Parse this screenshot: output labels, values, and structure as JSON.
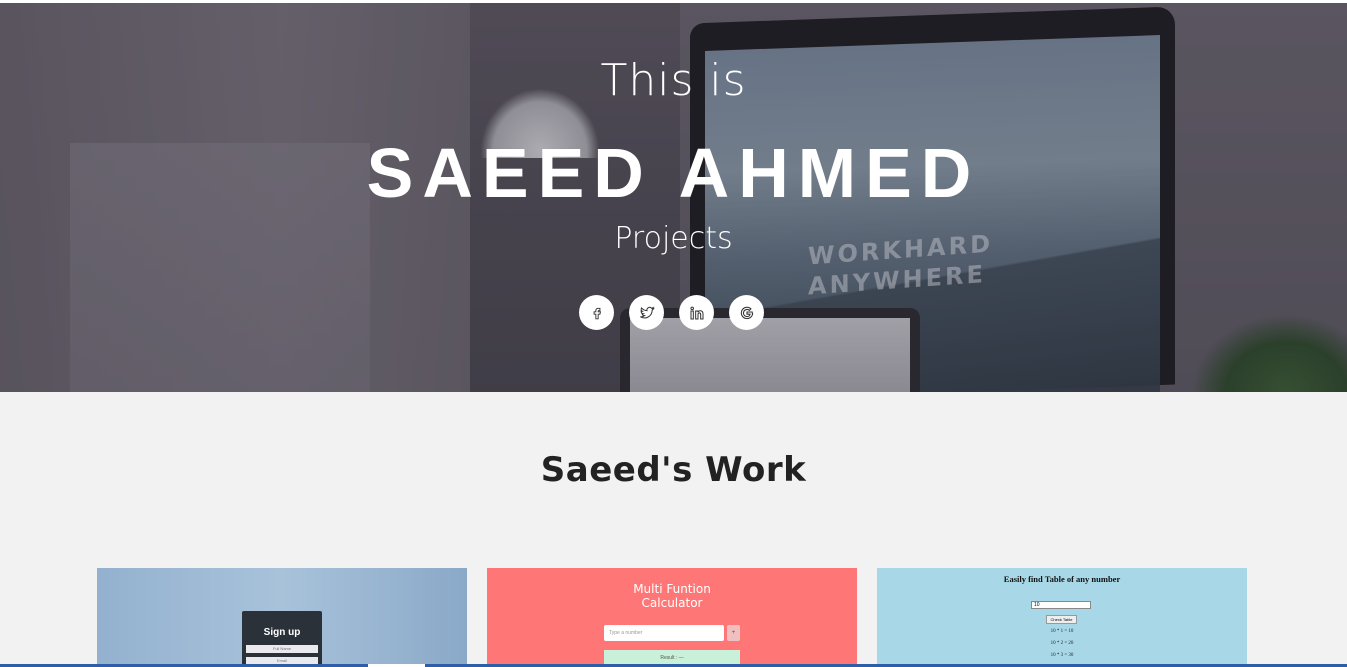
{
  "hero": {
    "intro": "This is",
    "name": "SAEED AHMED",
    "subtitle": "Projects",
    "background_text": "WORKHARD\nANYWHERE",
    "socials": [
      {
        "name": "facebook",
        "glyph": "f"
      },
      {
        "name": "twitter",
        "glyph": "🐦"
      },
      {
        "name": "linkedin",
        "glyph": "in"
      },
      {
        "name": "google",
        "glyph": "G"
      }
    ]
  },
  "work": {
    "title": "Saeed's Work",
    "cards": [
      {
        "signup_title": "Sign up",
        "fields": [
          "Full Name",
          "Email"
        ]
      },
      {
        "title_line1": "Multi Funtion",
        "title_line2": "Calculator",
        "input_placeholder": "Type a number",
        "button": "+",
        "result": "Result : —"
      },
      {
        "title": "Easily find Table of any number",
        "input_value": "10",
        "button": "Check Table",
        "lines": [
          "10 * 1 = 10",
          "10 * 2 = 20",
          "10 * 3 = 30"
        ]
      }
    ]
  }
}
